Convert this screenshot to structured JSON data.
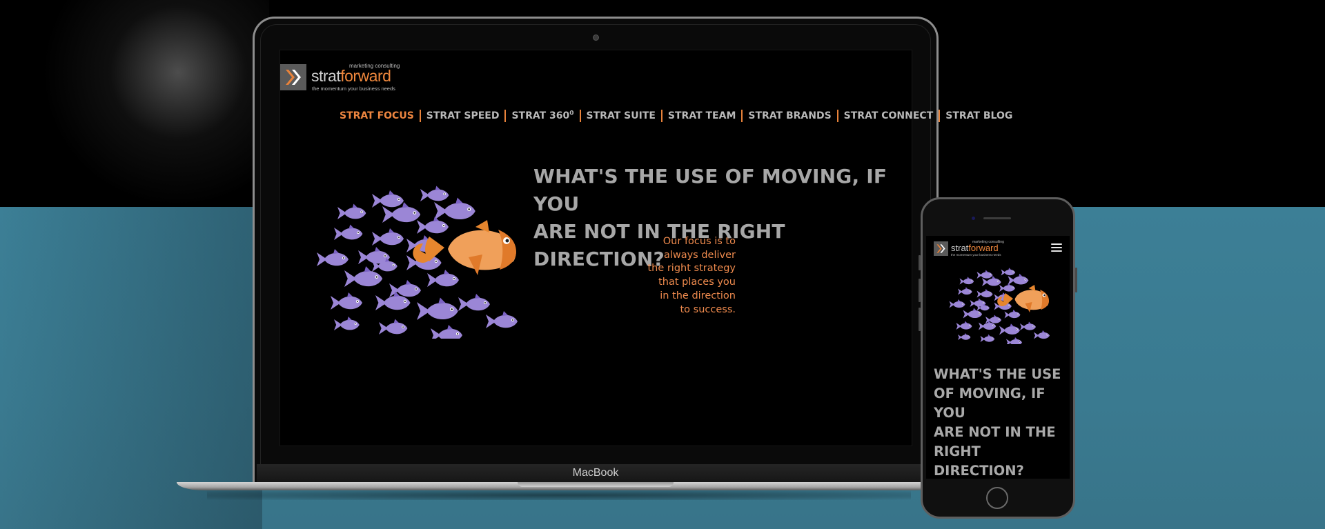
{
  "brand": {
    "tagline_top": "marketing consulting",
    "word_strat": "strat",
    "word_forward": "forward",
    "tagline_bottom": "the momentum your business needs"
  },
  "nav": {
    "items": [
      {
        "label": "STRAT FOCUS",
        "active": true
      },
      {
        "label": "STRAT SPEED"
      },
      {
        "label": "STRAT 360",
        "sup": "0"
      },
      {
        "label": "STRAT SUITE"
      },
      {
        "label": "STRAT TEAM"
      },
      {
        "label": "STRAT BRANDS"
      },
      {
        "label": "STRAT CONNECT"
      },
      {
        "label": "STRAT BLOG"
      }
    ]
  },
  "hero": {
    "headline_line1": "WHAT'S THE USE OF MOVING, IF YOU",
    "headline_line2": "ARE NOT IN THE RIGHT DIRECTION?",
    "focus_lines": [
      "Our focus is to",
      "always deliver",
      "the right strategy",
      "that places you",
      "in the direction",
      "to success."
    ]
  },
  "mobile": {
    "headline_lines": [
      "WHAT'S THE USE",
      "OF MOVING, IF",
      "YOU",
      "ARE NOT IN THE",
      "RIGHT",
      "DIRECTION?"
    ]
  },
  "device": {
    "laptop_label": "MacBook"
  },
  "colors": {
    "accent": "#ee8640",
    "fish_purple": "#9b86d6",
    "fish_orange": "#f0a05a",
    "background_teal": "#3c7f96"
  },
  "icons": {
    "menu": "hamburger-icon",
    "logo": "chevron-arrows-icon"
  }
}
